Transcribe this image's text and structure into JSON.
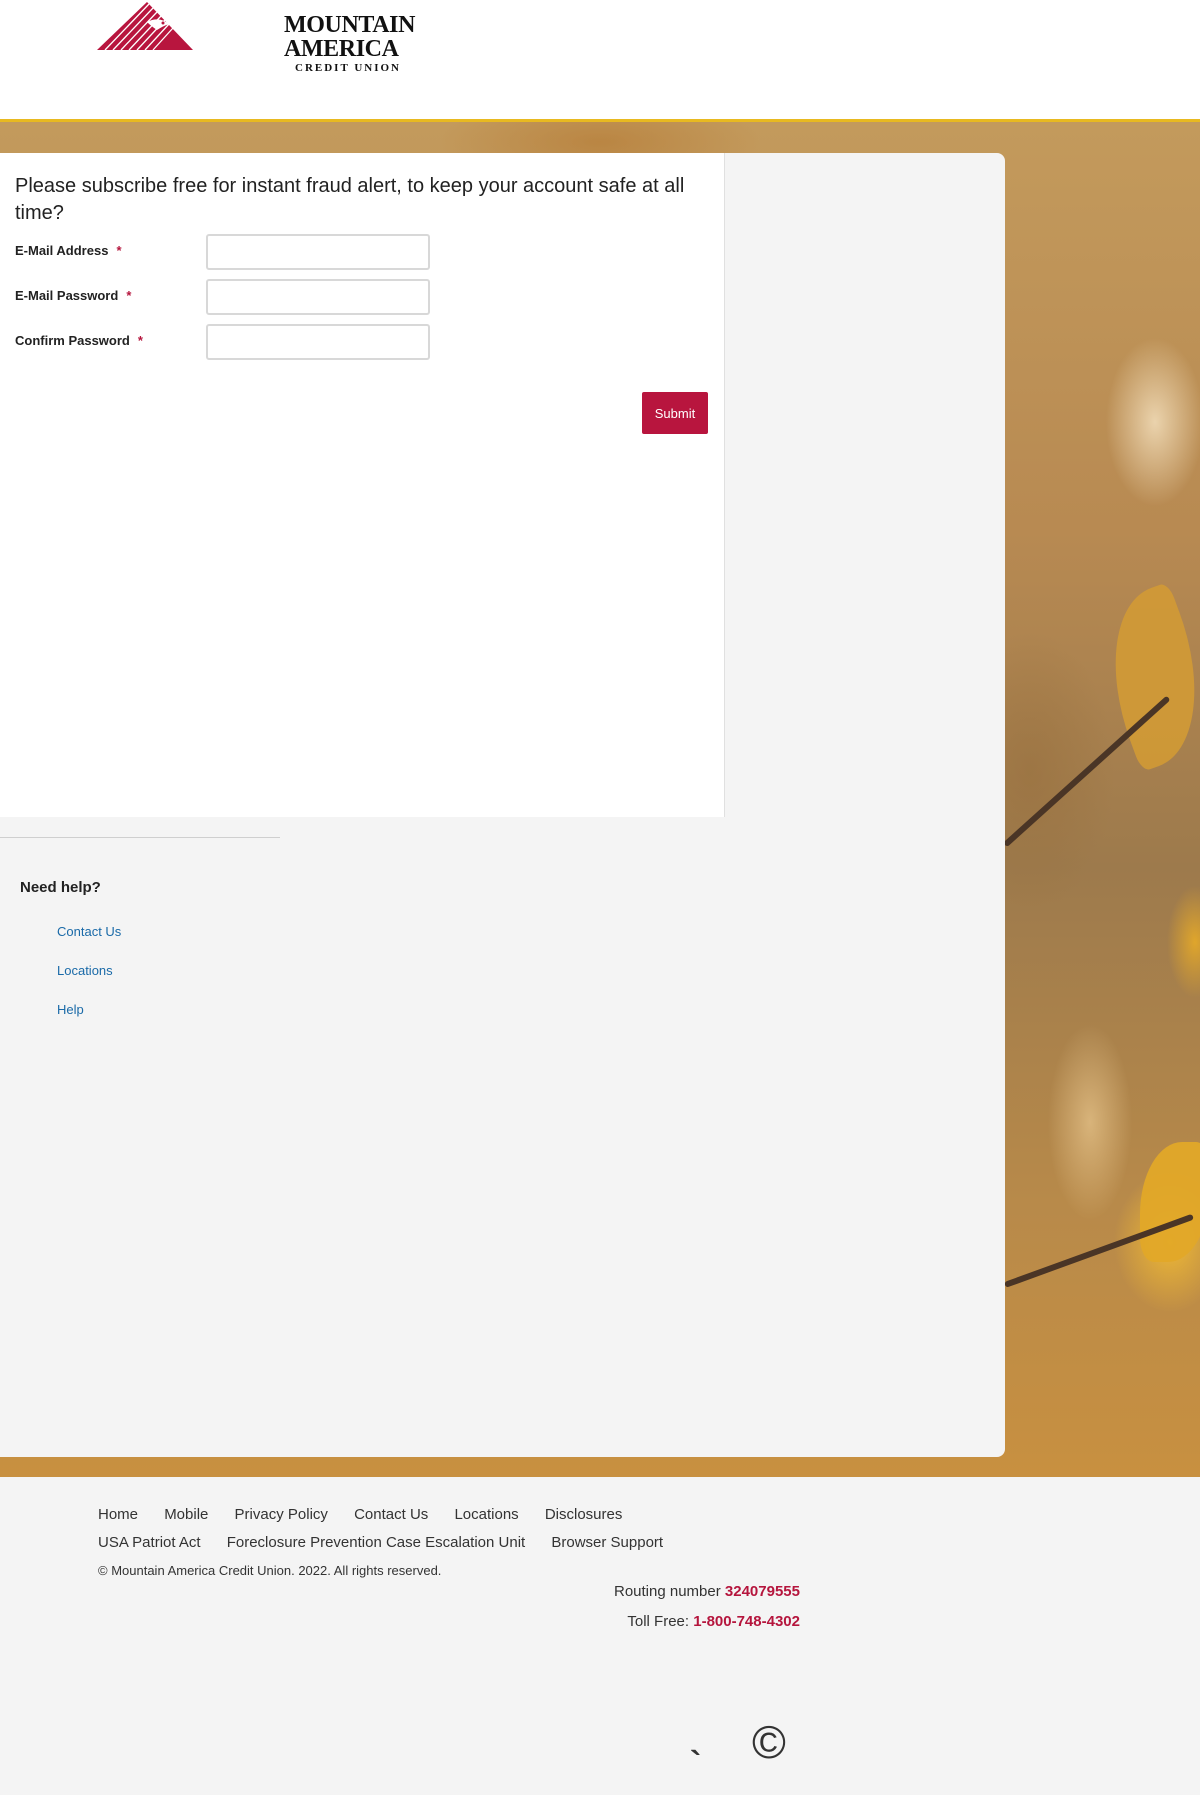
{
  "brand": {
    "name": "MOUNTAIN AMERICA",
    "sub": "CREDIT UNION",
    "color": "#b8153e",
    "accent": "#e8b920"
  },
  "form": {
    "title": "Please subscribe free for instant fraud alert, to keep your account safe at all time?",
    "fields": [
      {
        "label": "E-Mail Address",
        "required": "*",
        "value": ""
      },
      {
        "label": "E-Mail Password",
        "required": "*",
        "value": ""
      },
      {
        "label": "Confirm Password",
        "required": "*",
        "value": ""
      }
    ],
    "submit_label": "Submit"
  },
  "help": {
    "title": "Need help?",
    "links": [
      "Contact Us",
      "Locations",
      "Help"
    ]
  },
  "footer": {
    "links": [
      "Home",
      "Mobile",
      "Privacy Policy",
      "Contact Us",
      "Locations",
      "Disclosures",
      "USA Patriot Act",
      "Foreclosure Prevention Case Escalation Unit",
      "Browser Support"
    ],
    "copyright": "© Mountain America Credit Union. 2022. All rights reserved.",
    "routing_label": "Routing number",
    "routing_number": "324079555",
    "tollfree_label": "Toll Free:",
    "tollfree_number": "1-800-748-4302",
    "glyph_copyright": "©",
    "glyph_tick": "`"
  }
}
